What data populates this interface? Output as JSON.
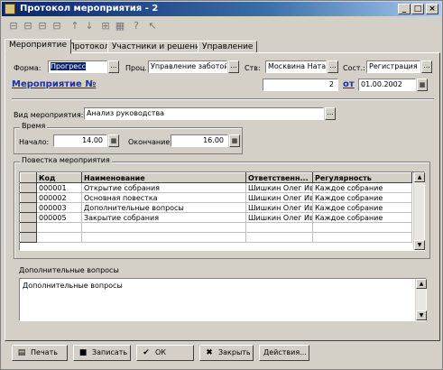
{
  "window": {
    "title": "Протокол мероприятия - 2",
    "min": "_",
    "max": "□",
    "close": "×"
  },
  "toolbar": {
    "icons": [
      "page-first-icon",
      "page-prev-icon",
      "page-next-icon",
      "page-last-icon",
      "arrow-up-icon",
      "arrow-down-icon",
      "tree-icon",
      "grid-icon",
      "help-icon",
      "pointer-help-icon"
    ]
  },
  "tabs": [
    {
      "label": "Мероприятие",
      "active": true
    },
    {
      "label": "Протокол"
    },
    {
      "label": "Участники и решения"
    },
    {
      "label": "Управление"
    }
  ],
  "form": {
    "forma_label": "Форма:",
    "forma_value": "Прогресс",
    "proc_label": "Проц.:",
    "proc_value": "Управление заботой",
    "stv_label": "Ств:",
    "stv_value": "Москвина Ната",
    "sost_label": "Сост.:",
    "sost_value": "Регистрация",
    "event_link": "Мероприятие №",
    "event_number": "2",
    "ot_label": "от",
    "event_date": "01.00.2002",
    "vid_label": "Вид мероприятия:",
    "vid_value": "Анализ руководства",
    "time_group": "Время",
    "start_label": "Начало:",
    "start_value": "14.00",
    "end_label": "Окончание:",
    "end_value": "16.00"
  },
  "agenda": {
    "group_title": "Повестка мероприятия",
    "columns": [
      "Код",
      "Наименование",
      "Ответственн...",
      "Регулярность"
    ],
    "rows": [
      {
        "code": "000001",
        "name": "Открытие собрания",
        "resp": "Шишкин Олег Ив",
        "reg": "Каждое собрание"
      },
      {
        "code": "000002",
        "name": "Основная повестка",
        "resp": "Шишкин Олег Ив",
        "reg": "Каждое собрание"
      },
      {
        "code": "000003",
        "name": "Дополнительные вопросы",
        "resp": "Шишкин Олег Ив",
        "reg": "Каждое собрание"
      },
      {
        "code": "000005",
        "name": "Закрытие собрания",
        "resp": "Шишкин Олег Ив",
        "reg": "Каждое собрание"
      }
    ]
  },
  "extra": {
    "group_title": "Дополнительные вопросы",
    "text": "Дополнительные вопросы"
  },
  "buttons": {
    "print": "Печать",
    "save": "Записать",
    "ok": "ОК",
    "close": "Закрыть",
    "more": "Действия..."
  }
}
